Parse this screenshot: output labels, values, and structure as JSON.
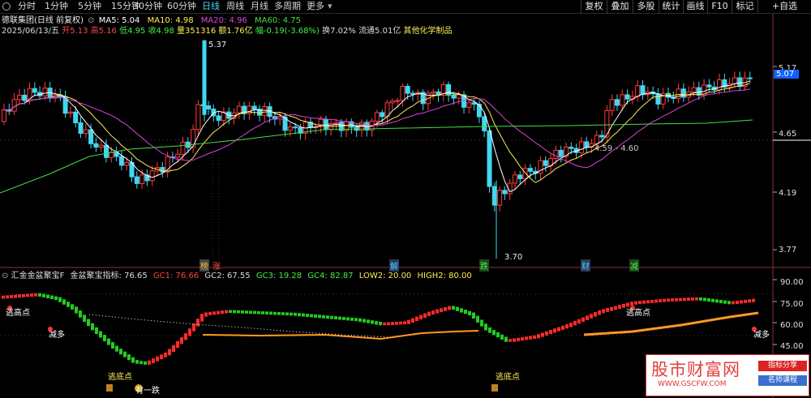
{
  "toolbar": {
    "periods": [
      "分时",
      "1分钟",
      "5分钟",
      "15分钟",
      "30分钟",
      "60分钟",
      "日线",
      "周线",
      "月线",
      "多周期",
      "更多"
    ],
    "active": "日线",
    "right_buttons": [
      "复权",
      "叠加",
      "多股",
      "统计",
      "画线",
      "F10",
      "标记",
      "+自选"
    ]
  },
  "stock": {
    "name": "德联集团(日线 前复权)",
    "ma5": "MA5: 5.04",
    "ma10": "MA10: 4.98",
    "ma20": "MA20: 4.96",
    "ma60": "MA60: 4.75",
    "date": "2025/06/13/五",
    "open": "开5.13",
    "high": "高5.16",
    "low": "低4.95",
    "close": "收4.98",
    "vol": "量351316",
    "amt": "额1.76亿",
    "chg": "幅-0.19(-3.68%)",
    "turnover": "换7.02%",
    "float": "流通5.01亿",
    "sector": "其他化学制品"
  },
  "colors": {
    "up": "#ff3b3b",
    "down": "#40d8f0",
    "ma5": "#ffffff",
    "ma10": "#ffee55",
    "ma20": "#dd44dd",
    "ma60": "#44dd44",
    "text": "#dddddd"
  },
  "chart_data": {
    "type": "candlestick",
    "price_axis_labels": [
      "5.17",
      "4.65",
      "4.19",
      "3.77"
    ],
    "current_price": "5.07",
    "labels": {
      "high": "5.37",
      "low": "3.70",
      "range": "4.59 - 4.60"
    },
    "ma": {
      "MA5": 5.04,
      "MA10": 4.98,
      "MA20": 4.96,
      "MA60": 4.75
    },
    "event_markers": [
      "榜",
      "涨",
      "解",
      "跌",
      "财",
      "减"
    ]
  },
  "indicator": {
    "name": "汇金金盆聚宝F",
    "main": "金盆聚宝指标: 76.65",
    "gc1": "GC1: 76.66",
    "gc2": "GC2: 67.55",
    "gc3": "GC3: 19.28",
    "gc4": "GC4: 82.87",
    "low2": "LOW2: 20.00",
    "high2": "HIGH2: 80.00",
    "axis": [
      "90.00",
      "75.00",
      "60.00",
      "45.00"
    ],
    "annotations": {
      "escape_top_1": "逃高点",
      "escape_top_2": "逃高点",
      "bottom_1": "逃底点",
      "bottom_2": "逃底点",
      "short_1": "减多",
      "short_2": "减多",
      "note": "有一跌"
    }
  },
  "watermark": {
    "title": "股市财富网",
    "url": "WWW.GSCFW.COM",
    "badge1": "指标分享",
    "badge2": "名师课程"
  }
}
